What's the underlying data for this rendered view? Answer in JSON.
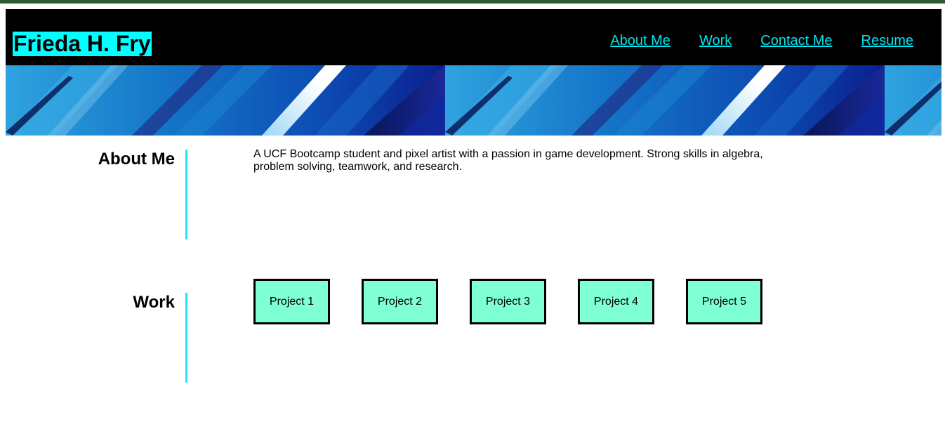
{
  "header": {
    "brand": "Frieda H. Fry",
    "nav": [
      {
        "label": "About Me"
      },
      {
        "label": "Work"
      },
      {
        "label": "Contact Me"
      },
      {
        "label": "Resume"
      }
    ]
  },
  "about": {
    "title": "About Me",
    "text": "A UCF Bootcamp student and pixel artist with a passion in game development. Strong skills in algebra, problem solving, teamwork, and research."
  },
  "work": {
    "title": "Work",
    "projects": [
      {
        "label": "Project 1"
      },
      {
        "label": "Project 2"
      },
      {
        "label": "Project 3"
      },
      {
        "label": "Project 4"
      },
      {
        "label": "Project 5"
      }
    ]
  },
  "colors": {
    "header_bg": "#000000",
    "brand_bg": "#00ffff",
    "nav_link": "#00e5ee",
    "section_rule": "#22e5f0",
    "project_bg": "#7fffd4",
    "top_stripe": "#2f5a2f"
  }
}
